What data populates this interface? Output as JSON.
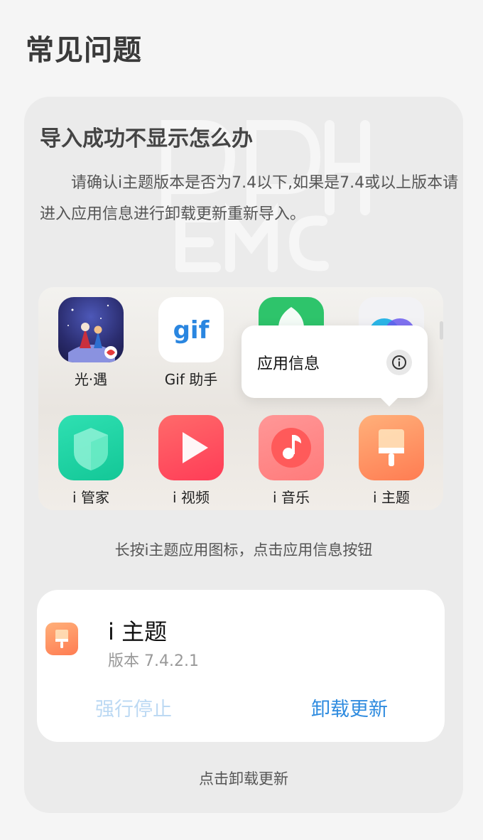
{
  "page": {
    "title": "常见问题"
  },
  "faq": {
    "question": "导入成功不显示怎么办",
    "answer": "请确认i主题版本是否为7.4以下,如果是7.4或以上版本请进入应用信息进行卸载更新重新导入。"
  },
  "home_screen": {
    "apps": [
      {
        "label": "光·遇",
        "icon": "sky-game-icon"
      },
      {
        "label": "Gif 助手",
        "icon": "gif-icon"
      },
      {
        "label": "",
        "icon": "green-app-icon"
      },
      {
        "label": "",
        "icon": "blue-app-icon"
      },
      {
        "label": "i 管家",
        "icon": "iguanjia-icon"
      },
      {
        "label": "i 视频",
        "icon": "ivideo-icon"
      },
      {
        "label": "i 音乐",
        "icon": "imusic-icon"
      },
      {
        "label": "i 主题",
        "icon": "itheme-icon"
      }
    ],
    "gif_text": "gif",
    "popup": {
      "label": "应用信息",
      "icon": "info-icon"
    }
  },
  "caption_step1": "长按i主题应用图标，点击应用信息按钮",
  "app_info": {
    "name": "i 主题",
    "version": "版本 7.4.2.1",
    "force_stop": "强行停止",
    "uninstall_update": "卸载更新"
  },
  "caption_step2": "点击卸载更新",
  "colors": {
    "accent": "#2e8bdf",
    "disabled": "#bcd9f3",
    "theme_icon": "#ff8a5c"
  }
}
